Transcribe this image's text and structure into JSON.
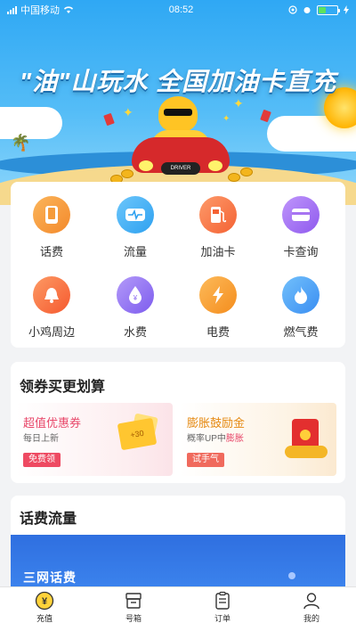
{
  "status_bar": {
    "carrier": "中国移动",
    "time": "08:52"
  },
  "hero": {
    "title": "\"油\"山玩水 全国加油卡直充",
    "car_plate": "DRIVER"
  },
  "services": [
    {
      "label": "话费",
      "icon": "phone-icon",
      "color": "#f7a13a"
    },
    {
      "label": "流量",
      "icon": "pulse-icon",
      "color": "#49b3f5"
    },
    {
      "label": "加油卡",
      "icon": "fuel-pump-icon",
      "color": "#fb7d4d"
    },
    {
      "label": "卡查询",
      "icon": "card-icon",
      "color": "#a774f2"
    },
    {
      "label": "小鸡周边",
      "icon": "bell-icon",
      "color": "#fb7a45"
    },
    {
      "label": "水费",
      "icon": "water-drop-icon",
      "color": "#9a7ef3"
    },
    {
      "label": "电费",
      "icon": "lightning-icon",
      "color": "#f9a33a"
    },
    {
      "label": "燃气费",
      "icon": "flame-icon",
      "color": "#4fa8f7"
    }
  ],
  "coupons": {
    "title": "领券买更划算",
    "items": [
      {
        "title": "超值优惠券",
        "subtitle": "每日上新",
        "button": "免费领",
        "ticket_text": "+30"
      },
      {
        "title": "膨胀鼓励金",
        "subtitle_prefix": "概率UP中",
        "subtitle_highlight": "膨胀",
        "button": "试手气"
      }
    ]
  },
  "flow": {
    "title": "话费流量",
    "banner_text": "三网话费"
  },
  "tabbar": [
    {
      "label": "充值",
      "icon": "recharge-icon",
      "active": true
    },
    {
      "label": "号箱",
      "icon": "box-icon",
      "active": false
    },
    {
      "label": "订单",
      "icon": "order-list-icon",
      "active": false
    },
    {
      "label": "我的",
      "icon": "user-icon",
      "active": false
    }
  ]
}
